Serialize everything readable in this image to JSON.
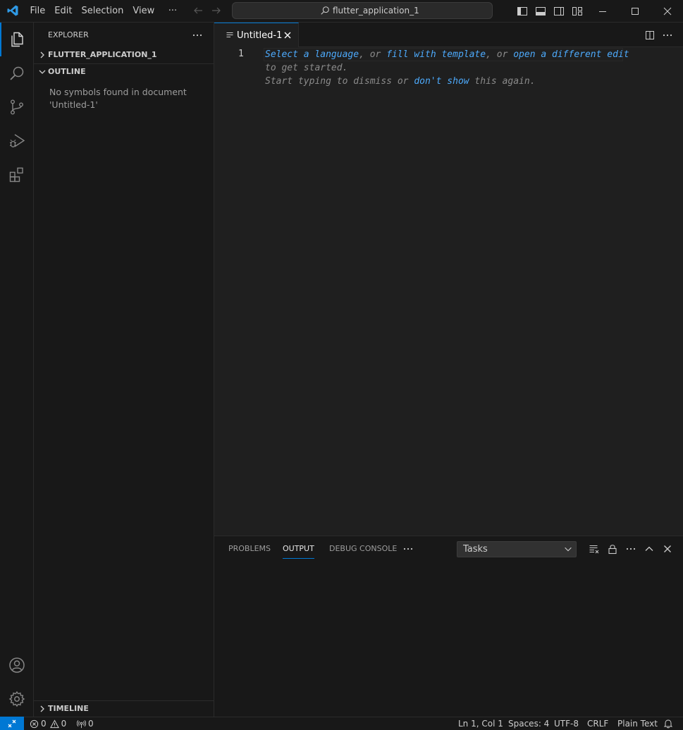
{
  "titlebar": {
    "menu": [
      "File",
      "Edit",
      "Selection",
      "View",
      "···"
    ],
    "command_center": "flutter_application_1"
  },
  "activity_bar": {
    "items": [
      "explorer-icon",
      "search-icon",
      "source-control-icon",
      "run-debug-icon",
      "extensions-icon"
    ],
    "bottom": [
      "accounts-icon",
      "manage-gear-icon"
    ]
  },
  "sidebar": {
    "title": "EXPLORER",
    "sections": {
      "folder": "FLUTTER_APPLICATION_1",
      "outline": "OUTLINE",
      "outline_message": "No symbols found in document 'Untitled-1'",
      "timeline": "TIMELINE"
    }
  },
  "editor": {
    "tab_label": "Untitled-1",
    "line_number": "1",
    "hint": {
      "select_language": "Select a language",
      "or1": ", or ",
      "fill_template": "fill with template",
      "or2": ", or ",
      "open_editor": "open a different edit",
      "line2": "to get started.",
      "line3_a": "Start typing to dismiss or ",
      "dont_show": "don't show",
      "line3_b": " this again."
    }
  },
  "panel": {
    "tabs": [
      "PROBLEMS",
      "OUTPUT",
      "DEBUG CONSOLE"
    ],
    "active_tab": "OUTPUT",
    "output_channel": "Tasks"
  },
  "statusbar": {
    "errors": "0",
    "warnings": "0",
    "ports": "0",
    "position": "Ln 1, Col 1",
    "spaces": "Spaces: 4",
    "encoding": "UTF-8",
    "eol": "CRLF",
    "language": "Plain Text"
  },
  "colors": {
    "accent": "#0078d4",
    "link": "#4daafc",
    "background": "#1f1f1f",
    "chrome": "#181818"
  }
}
